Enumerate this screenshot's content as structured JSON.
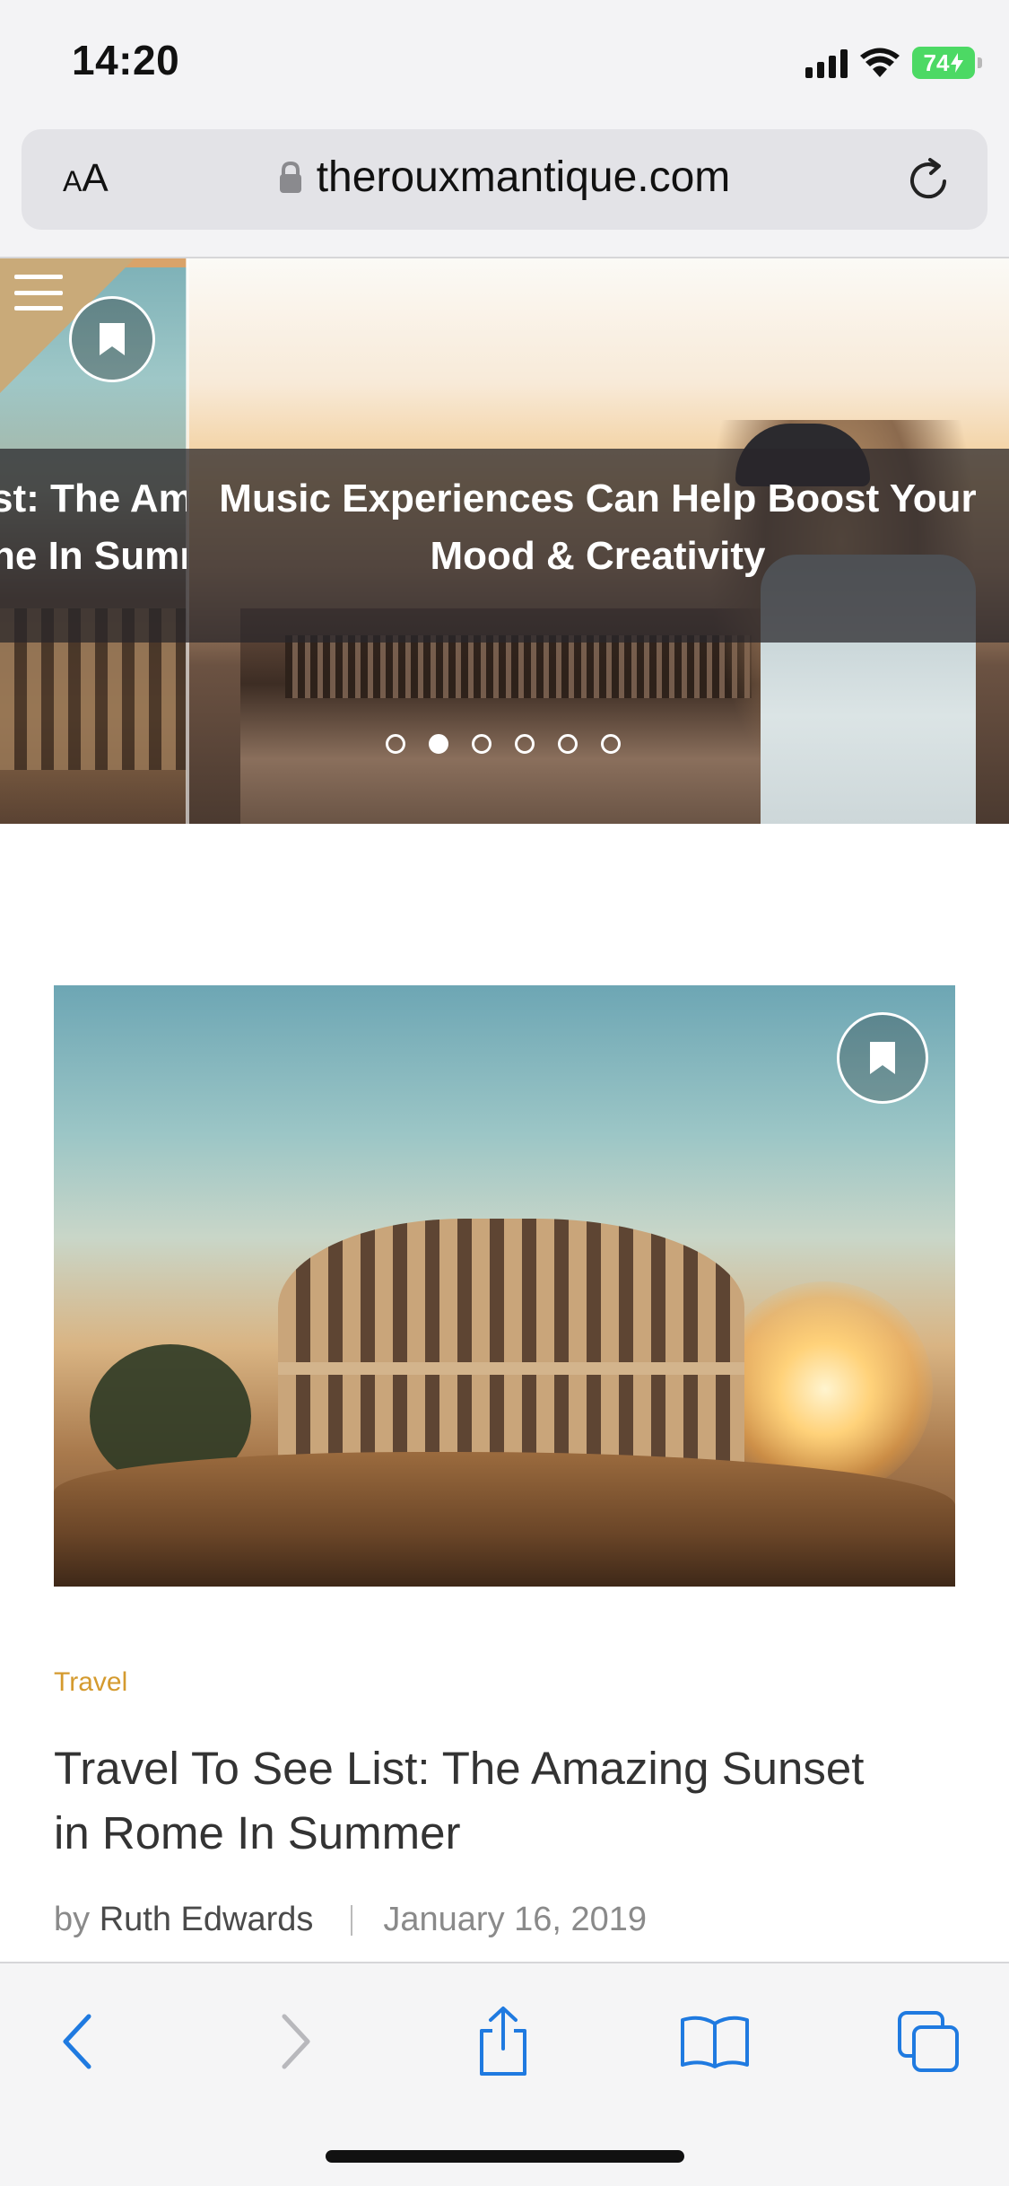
{
  "status_bar": {
    "time": "14:20",
    "battery": "74"
  },
  "browser": {
    "aa_small": "A",
    "aa_large": "A",
    "url": "therouxmantique.com"
  },
  "hero": {
    "prev_slide_caption_line1": "st: The Am",
    "prev_slide_caption_line2": "ne In Sumr",
    "caption_line1": "Music Experiences Can Help Boost Your",
    "caption_line2": "Mood & Creativity",
    "slide_count": 6,
    "active_slide_index": 1
  },
  "article": {
    "category": "Travel",
    "title_line1": "Travel To See List: The Amazing Sunset",
    "title_line2": "in Rome In Summer",
    "by_label": "by",
    "author": "Ruth Edwards",
    "date": "January 16, 2019"
  },
  "colors": {
    "accent_category": "#d49a2e",
    "ios_blue": "#1f7ae0",
    "battery_green": "#4cd964"
  },
  "icons": {
    "menu": "hamburger-icon",
    "bookmark": "bookmark-icon",
    "lock": "lock-icon",
    "reload": "reload-icon",
    "back": "chevron-left-icon",
    "forward": "chevron-right-icon",
    "share": "share-icon",
    "bookmarks": "book-icon",
    "tabs": "tabs-icon"
  }
}
